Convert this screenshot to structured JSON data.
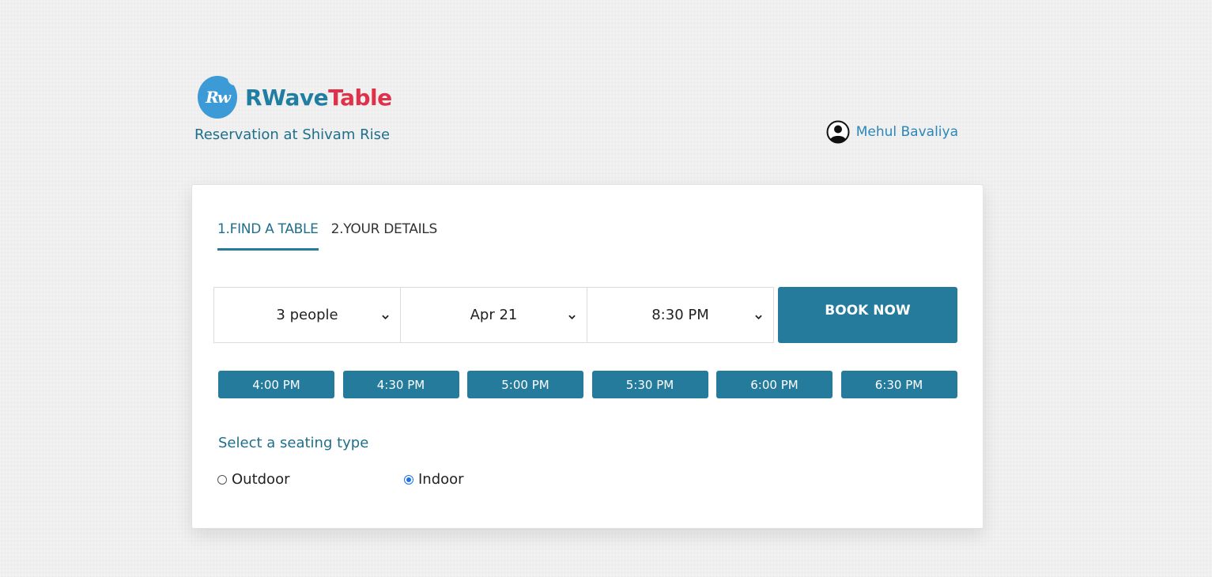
{
  "brand": {
    "name_part1": "RWave",
    "name_part2": "Table",
    "monogram": "Rw",
    "colors": {
      "primary": "#1f7ea1",
      "accent": "#e0314a",
      "mark": "#3c9ad6"
    }
  },
  "header": {
    "subtitle": "Reservation at Shivam Rise",
    "user_name": "Mehul Bavaliya"
  },
  "tabs": [
    {
      "label": "1.FIND A TABLE",
      "active": true
    },
    {
      "label": "2.YOUR DETAILS",
      "active": false
    }
  ],
  "selectors": {
    "party_size": "3 people",
    "date": "Apr 21",
    "time": "8:30 PM"
  },
  "book_button": "BOOK NOW",
  "time_slots": [
    "4:00 PM",
    "4:30 PM",
    "5:00 PM",
    "5:30 PM",
    "6:00 PM",
    "6:30 PM"
  ],
  "seating": {
    "title": "Select a seating type",
    "options": [
      {
        "label": "Outdoor",
        "checked": false
      },
      {
        "label": "Indoor",
        "checked": true
      }
    ]
  },
  "theme": {
    "button": "#247b9c",
    "heading": "#1f6f8b",
    "link": "#2a86b8"
  }
}
